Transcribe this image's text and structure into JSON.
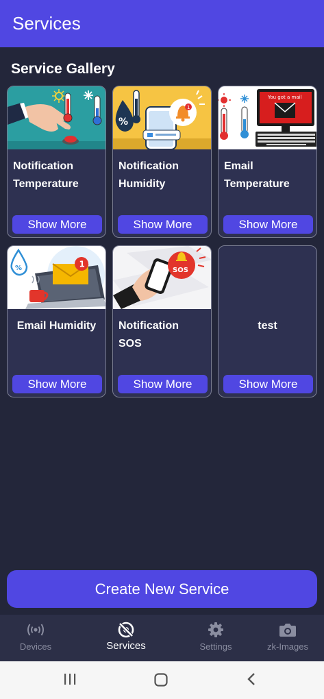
{
  "app_bar": {
    "title": "Services"
  },
  "gallery": {
    "title": "Service Gallery",
    "cards": [
      {
        "title": "Notification\nTemperature",
        "button": "Show More",
        "image": "hand-pressing-button-thermometers"
      },
      {
        "title": "Notification\nHumidity",
        "button": "Show More",
        "image": "humidity-phone-bell"
      },
      {
        "title": "Email\nTemperature",
        "button": "Show More",
        "image": "thermometers-computer-mail"
      },
      {
        "title": "Email Humidity",
        "button": "Show More",
        "image": "laptop-mail-humidity"
      },
      {
        "title": "Notification\nSOS",
        "button": "Show More",
        "image": "hand-phone-sos"
      },
      {
        "title": "test",
        "button": "Show More",
        "image": "none"
      }
    ],
    "email_banner_text": "You got a mail",
    "email_badge_count": "1",
    "sos_badge_text": "SOS"
  },
  "create_button": {
    "label": "Create New Service"
  },
  "bottom_nav": {
    "items": [
      {
        "label": "Devices",
        "icon": "broadcast-icon",
        "active": false
      },
      {
        "label": "Services",
        "icon": "services-icon",
        "active": true
      },
      {
        "label": "Settings",
        "icon": "gear-icon",
        "active": false
      },
      {
        "label": "zk-Images",
        "icon": "camera-icon",
        "active": false
      }
    ]
  },
  "colors": {
    "background": "#23263a",
    "accent": "#5047e2",
    "card": "#2e3151",
    "nav": "#2c2f47"
  }
}
